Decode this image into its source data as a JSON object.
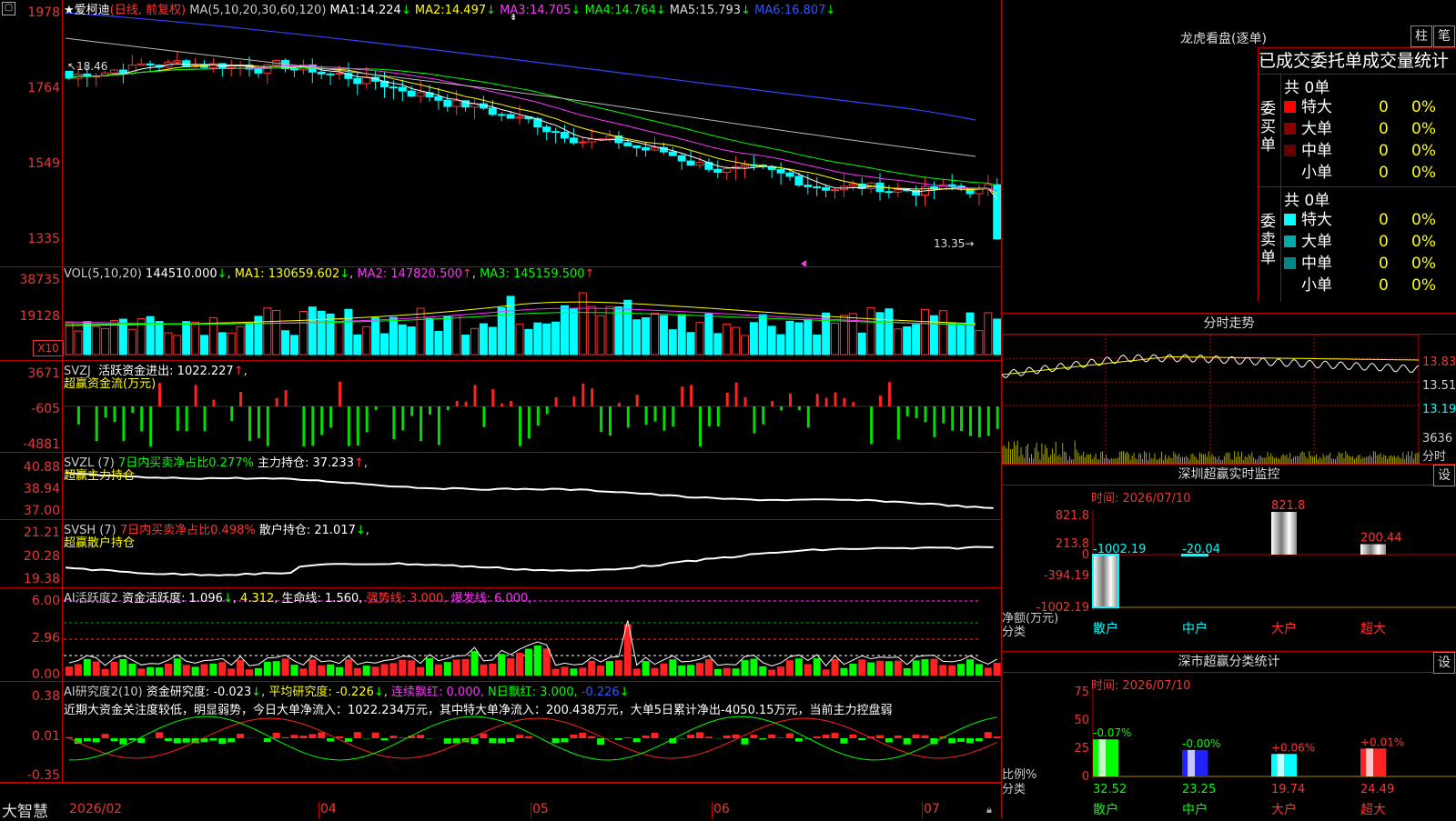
{
  "stock": {
    "name": "爱柯迪",
    "mode": "(日线, 前复权)",
    "ma_label": "MA(5,10,20,30,60,120)",
    "ma": [
      {
        "label": "MA1:",
        "value": "14.224",
        "arrow": "↓",
        "color": "#ffffff"
      },
      {
        "label": "MA2:",
        "value": "14.497",
        "arrow": "↓",
        "color": "#ffff00"
      },
      {
        "label": "MA3:",
        "value": "14.705",
        "arrow": "↓",
        "color": "#ff33ff"
      },
      {
        "label": "MA4:",
        "value": "14.764",
        "arrow": "↓",
        "color": "#00ff00"
      },
      {
        "label": "MA5:",
        "value": "15.793",
        "arrow": "↓",
        "color": "#bbbbbb"
      },
      {
        "label": "MA6:",
        "value": "16.807",
        "arrow": "↓",
        "color": "#3344ff"
      }
    ],
    "price_axis": [
      "1978",
      "1764",
      "1549",
      "1335"
    ],
    "high_marker": "18.46",
    "low_marker": "13.35"
  },
  "vol": {
    "label": "VOL(5,10,20)",
    "value": "144510.000",
    "ma1": "MA1: 130659.602",
    "ma2": "MA2: 147820.500",
    "ma3": "MA3: 145159.500",
    "axis": [
      "38735",
      "19128"
    ],
    "unit": "X10"
  },
  "svzj": {
    "label": "SVZJ",
    "text": "活跃资金进出: 1022.227",
    "subtitle": "超赢资金流(万元)",
    "axis": [
      "3671",
      "-605",
      "-4881"
    ]
  },
  "svzl": {
    "label": "SVZL (7)",
    "text1": "7日内买卖净占比0.277%",
    "text2": "主力持仓: 37.233",
    "subtitle": "超赢主力持仓",
    "axis": [
      "40.88",
      "38.94",
      "37.00"
    ]
  },
  "svsh": {
    "label": "SVSH (7)",
    "text1": "7日内买卖净占比0.498%",
    "text2": "散户持仓: 21.017",
    "subtitle": "超赢散户持仓",
    "axis": [
      "21.21",
      "20.28",
      "19.38"
    ]
  },
  "ai1": {
    "label": "AI活跃度2",
    "text1": "资金活跃度: 1.096",
    "text2": "4.312,",
    "text3": "生命线: 1.560,",
    "text4": "强势线: 3.000,",
    "text5": "爆发线: 6.000,",
    "axis": [
      "6.00",
      "2.96",
      "0.00"
    ]
  },
  "ai2": {
    "label": "AI研究度2(10)",
    "text1": "资金研究度: -0.023",
    "text2": "平均研究度: -0.226",
    "text3": "连续飘红: 0.000,",
    "text4": "N日飘红: 3.000,",
    "text5": "-0.226",
    "note": "近期大资金关注度较低，明显弱势，今日大单净流入：1022.234万元，其中特大单净流入：200.438万元，大单5日累计净出-4050.15万元，当前主力控盘弱",
    "axis": [
      "0.38",
      "0.01",
      "-0.35"
    ]
  },
  "xaxis": [
    "2026/02",
    "04",
    "05",
    "06",
    "07"
  ],
  "footer": {
    "brand": "大智慧"
  },
  "dragon": {
    "title": "龙虎看盘(逐单)",
    "btn1": "柱",
    "btn2": "笔",
    "subtitle": "已成交委托单成交量统计",
    "buy_label": "委买单",
    "sell_label": "委卖单",
    "buy_total": "共 0单",
    "sell_total": "共 0单",
    "buy_rows": [
      {
        "name": "特大",
        "color": "#ff0000",
        "count": "0",
        "pct": "0%"
      },
      {
        "name": "大单",
        "color": "#880000",
        "count": "0",
        "pct": "0%"
      },
      {
        "name": "中单",
        "color": "#660000",
        "count": "0",
        "pct": "0%"
      },
      {
        "name": "小单",
        "color": "#000000",
        "count": "0",
        "pct": "0%"
      }
    ],
    "sell_rows": [
      {
        "name": "特大",
        "color": "#00ffff",
        "count": "0",
        "pct": "0%"
      },
      {
        "name": "大单",
        "color": "#00aaaa",
        "count": "0",
        "pct": "0%"
      },
      {
        "name": "中单",
        "color": "#008888",
        "count": "0",
        "pct": "0%"
      },
      {
        "name": "小单",
        "color": "#000000",
        "count": "0",
        "pct": "0%"
      }
    ]
  },
  "intraday": {
    "title": "分时走势",
    "axis": [
      "13.83",
      "13.51",
      "13.19"
    ],
    "vol_axis": "3636",
    "vol_label": "分时"
  },
  "monitor": {
    "title": "深圳超赢实时监控",
    "btn": "设",
    "time": "时间: 2026/07/10",
    "axis": [
      "821.8",
      "213.8",
      "0",
      "-394.19",
      "-1002.19"
    ],
    "y_label1": "净额(万元)",
    "y_label2": "分类",
    "categories": [
      {
        "name": "散户",
        "value": "-1002.19",
        "raw": -1002.19
      },
      {
        "name": "中户",
        "value": "-20.04",
        "raw": -20.04
      },
      {
        "name": "大户",
        "value": "821.8",
        "raw": 821.8
      },
      {
        "name": "超大",
        "value": "200.44",
        "raw": 200.44
      }
    ]
  },
  "classstat": {
    "title": "深市超赢分类统计",
    "btn": "设",
    "time": "时间: 2026/07/10",
    "axis": [
      "75",
      "50",
      "25",
      "0"
    ],
    "y_label1": "比例%",
    "y_label2": "分类",
    "categories": [
      {
        "name": "散户",
        "pct": "32.52",
        "change": "-0.07%",
        "raw": 32.52,
        "color": "#00ff00"
      },
      {
        "name": "中户",
        "pct": "23.25",
        "change": "-0.00%",
        "raw": 23.25,
        "color": "#2222ff"
      },
      {
        "name": "大户",
        "pct": "19.74",
        "change": "+0.06%",
        "raw": 19.74,
        "color": "#00ffff"
      },
      {
        "name": "超大",
        "pct": "24.49",
        "change": "+0.01%",
        "raw": 24.49,
        "color": "#ff2222"
      }
    ]
  }
}
